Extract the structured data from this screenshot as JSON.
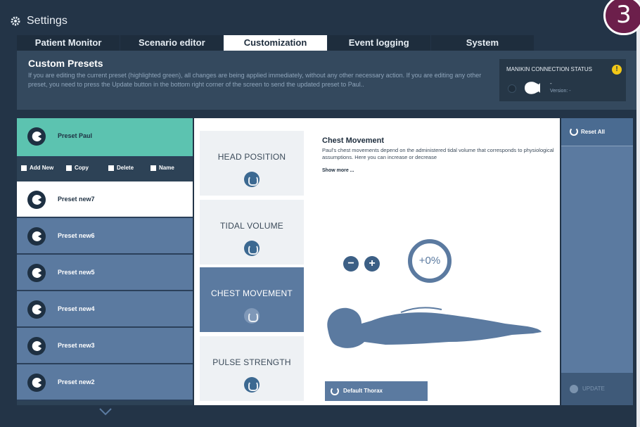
{
  "window": {
    "title": "Settings",
    "step_badge": "3"
  },
  "tabs": [
    {
      "label": "Patient Monitor"
    },
    {
      "label": "Scenario editor"
    },
    {
      "label": "Customization",
      "active": true
    },
    {
      "label": "Event logging"
    },
    {
      "label": "System"
    }
  ],
  "info": {
    "heading": "Custom Presets",
    "description": "If you are editing the current preset (highlighted green), all changes are being applied immediately, without any other necessary action. If you are editing any other preset, you need to press the Update button in the bottom right corner of the screen to send the updated preset to Paul..",
    "manikin": {
      "label": "MANIKIN CONNECTION STATUS",
      "status": "-",
      "version": "Version: -"
    }
  },
  "presets": {
    "current": "Preset Paul",
    "actions": {
      "add": "Add New",
      "copy": "Copy",
      "delete": "Delete",
      "name": "Name"
    },
    "items": [
      {
        "label": "Preset new7"
      },
      {
        "label": "Preset new6"
      },
      {
        "label": "Preset new5"
      },
      {
        "label": "Preset new4"
      },
      {
        "label": "Preset new3"
      },
      {
        "label": "Preset new2"
      }
    ]
  },
  "categories": [
    {
      "label": "HEAD POSITION"
    },
    {
      "label": "TIDAL VOLUME"
    },
    {
      "label": "CHEST MOVEMENT",
      "active": true
    },
    {
      "label": "PULSE STRENGTH"
    }
  ],
  "panel": {
    "title": "Chest Movement",
    "description": "Paul's chest movements depend on the administered tidal volume that corresponds to physiological assumptions. Here you can increase or decrease",
    "show_more": "Show more ...",
    "minus": "−",
    "plus": "+",
    "percent": "+0%",
    "default_button": "Default Thorax"
  },
  "sidebar": {
    "reset_all": "Reset All",
    "update": "UPDATE"
  },
  "colors": {
    "accent": "#5b7aa0",
    "current_preset": "#5cc3b0",
    "badge": "#6c1f4b",
    "background": "#233447"
  }
}
